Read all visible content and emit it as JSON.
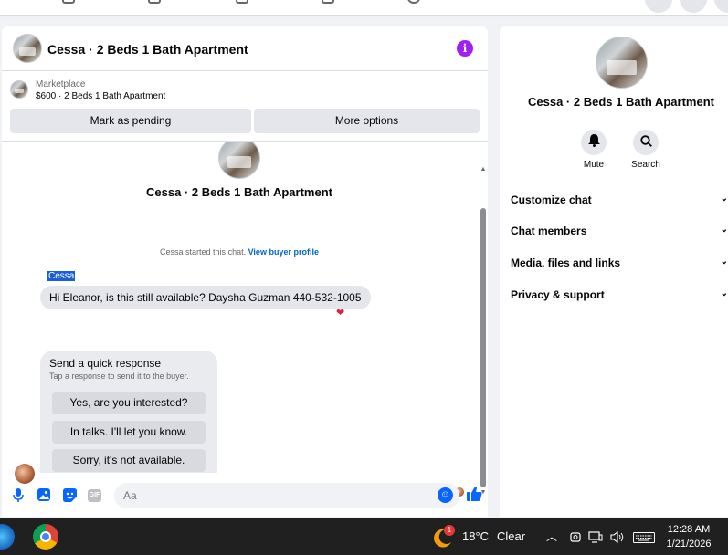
{
  "chat": {
    "title": "Cessa · 2 Beds 1 Bath Apartment",
    "listing_label": "Marketplace",
    "listing_price_title": "$600 · 2 Beds 1 Bath Apartment",
    "mark_pending_label": "Mark as pending",
    "more_options_label": "More options",
    "conversation_title": "Cessa · 2 Beds 1 Bath Apartment",
    "system_text": "Cessa started this chat.",
    "system_link": "View buyer profile",
    "sender_name": "Cessa",
    "message": "Hi Eleanor, is this still available? Daysha Guzman 440-532-1005",
    "reaction": "❤",
    "quick_response": {
      "title": "Send a quick response",
      "subtitle": "Tap a response to send it to the buyer.",
      "options": [
        "Yes, are you interested?",
        "In talks. I'll let you know.",
        "Sorry, it's not available."
      ]
    },
    "composer_placeholder": "Aa"
  },
  "info_panel": {
    "title": "Cessa · 2 Beds 1 Bath Apartment",
    "mute_label": "Mute",
    "search_label": "Search",
    "sections": [
      "Customize chat",
      "Chat members",
      "Media, files and links",
      "Privacy & support"
    ]
  },
  "taskbar": {
    "weather_badge": "1",
    "temperature": "18°C",
    "weather": "Clear",
    "time": "12:28 AM",
    "date": "1/21/2026"
  },
  "colors": {
    "accent": "#0866ff",
    "info_purple": "#a020f0",
    "taskbar": "#202020"
  }
}
